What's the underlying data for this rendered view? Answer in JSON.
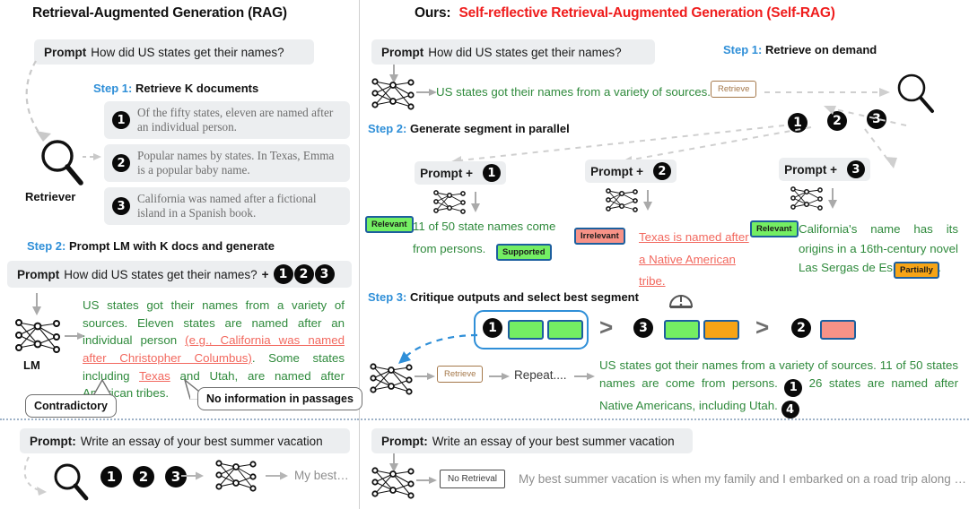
{
  "left": {
    "title": "Retrieval-Augmented Generation (RAG)",
    "prompt_label": "Prompt",
    "prompt_text": "How did US states get their names?",
    "step1_no": "Step 1:",
    "step1_text": "Retrieve K documents",
    "retriever_label": "Retriever",
    "docs": [
      {
        "num": "1",
        "text": "Of the fifty states, eleven are named after an individual person."
      },
      {
        "num": "2",
        "text": "Popular names by states. In Texas, Emma is a popular baby name."
      },
      {
        "num": "3",
        "text": "California was named after a fictional island in a Spanish book."
      }
    ],
    "step2_no": "Step 2:",
    "step2_text": "Prompt LM with K docs and generate",
    "prompt2_label": "Prompt",
    "prompt2_text": "How did US states get their names?",
    "prompt2_plus": "+",
    "prompt2_docs": [
      "1",
      "2",
      "3"
    ],
    "lm_label": "LM",
    "output_seg1": "US states got their names from a variety of sources. Eleven states are named after an individual person ",
    "output_bad1": "(e.g., California was named after Christopher Columbus)",
    "output_seg2": ". Some states including ",
    "output_bad2": "Texas",
    "output_seg3": " and Utah, are named after American tribes.",
    "callout_contradictory": "Contradictory",
    "callout_noinfo": "No information in passages",
    "bottom_prompt_label": "Prompt:",
    "bottom_prompt_text": "Write an essay of your best summer vacation",
    "bottom_docs": [
      "1",
      "2",
      "3"
    ],
    "bottom_output": "My best…"
  },
  "right": {
    "title_prefix": "Ours:",
    "title_main": "Self-reflective Retrieval-Augmented Generation (Self-RAG)",
    "prompt_label": "Prompt",
    "prompt_text": "How did US states get their names?",
    "step1_no": "Step 1:",
    "step1_text": "Retrieve on demand",
    "step1_output": "US states got their names from a variety of sources.",
    "retrieve_token": "Retrieve",
    "step1_docs": [
      "1",
      "2",
      "3"
    ],
    "step2_no": "Step 2:",
    "step2_text": "Generate segment in parallel",
    "branches": [
      {
        "header_label": "Prompt +",
        "header_num": "1",
        "badge1": "Relevant",
        "text_pre": "11 of 50 state names come from persons.",
        "badge2": "Supported",
        "badge_style": "green"
      },
      {
        "header_label": "Prompt +",
        "header_num": "2",
        "badge1": "Irrelevant",
        "text_pre": "Texas is named after a Native American tribe.",
        "badge2": "",
        "badge_style": "salmon"
      },
      {
        "header_label": "Prompt +",
        "header_num": "3",
        "badge1": "Relevant",
        "text_pre": "California's name has its origins in a 16th-century novel Las Sergas de Esplandián.",
        "badge2": "Partially",
        "badge_style": "green"
      }
    ],
    "step3_no": "Step 3:",
    "step3_text": "Critique outputs and select best segment",
    "critique_icon": "gauge-icon",
    "ranking": [
      {
        "num": "1",
        "chips": [
          "green",
          "green"
        ],
        "selected": true
      },
      {
        "num": "3",
        "chips": [
          "green",
          "orange"
        ],
        "selected": false
      },
      {
        "num": "2",
        "chips": [
          "salmon"
        ],
        "selected": false
      }
    ],
    "gt_symbol": ">",
    "retrieve_token2": "Retrieve",
    "repeat_label": "Repeat....",
    "final_output_a": "US states got their names from a variety of sources. 11 of 50 states names are come from persons.",
    "final_num_1": "1",
    "final_output_b": "26 states are named after Native Americans, including Utah.",
    "final_num_4": "4",
    "bottom_prompt_label": "Prompt:",
    "bottom_prompt_text": "Write an essay of your best summer vacation",
    "no_retrieval_token": "No Retrieval",
    "bottom_output": "My best summer vacation is when my family and I embarked on a road trip along …"
  },
  "colors": {
    "accent_blue": "#2f8fd8",
    "red": "#ef1d1d",
    "green_text": "#2f8a3c",
    "bad_red": "#f2685e",
    "badge_green": "#74ee63",
    "badge_salmon": "#f79287",
    "badge_orange": "#f6a416",
    "badge_border": "#1d5f9e",
    "token_brown": "#a5784a",
    "grey_text": "#8e8e8e"
  }
}
